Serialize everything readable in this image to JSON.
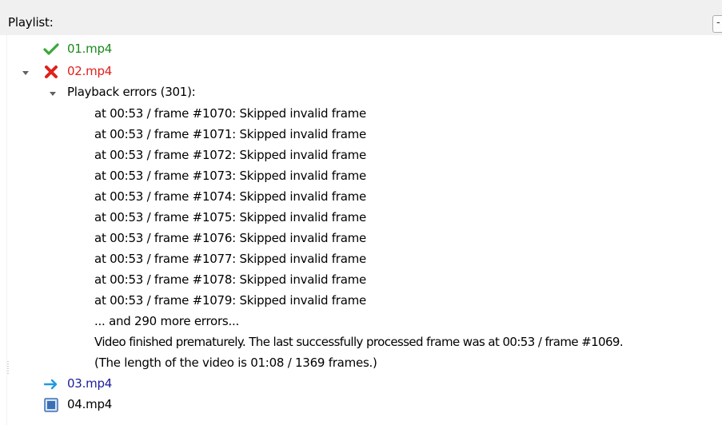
{
  "header": {
    "playlist_label": "Playlist:",
    "collapse_glyph": "-"
  },
  "playlist": {
    "items": [
      {
        "name": "01.mp4",
        "status": "success",
        "icon": "checkmark-icon",
        "color": "#1b8a1b"
      },
      {
        "name": "02.mp4",
        "status": "error",
        "icon": "red-x-icon",
        "color": "#e0201c",
        "expanded": true
      },
      {
        "name": "03.mp4",
        "status": "current",
        "icon": "arrow-right-icon",
        "color": "#1c1c9c"
      },
      {
        "name": "04.mp4",
        "status": "pending",
        "icon": "square-icon",
        "color": "#000000"
      }
    ],
    "errors": {
      "group_label": "Playback errors (301):",
      "lines": [
        "at 00:53 / frame #1070: Skipped invalid frame",
        "at 00:53 / frame #1071: Skipped invalid frame",
        "at 00:53 / frame #1072: Skipped invalid frame",
        "at 00:53 / frame #1073: Skipped invalid frame",
        "at 00:53 / frame #1074: Skipped invalid frame",
        "at 00:53 / frame #1075: Skipped invalid frame",
        "at 00:53 / frame #1076: Skipped invalid frame",
        "at 00:53 / frame #1077: Skipped invalid frame",
        "at 00:53 / frame #1078: Skipped invalid frame",
        "at 00:53 / frame #1079: Skipped invalid frame"
      ],
      "more": "... and 290 more errors...",
      "summary": "Video finished prematurely. The last successfully processed frame was at 00:53 / frame #1069.",
      "length_note": "(The length of the video is 01:08 / 1369 frames.)"
    }
  },
  "colors": {
    "success": "#1b8a1b",
    "error": "#e0201c",
    "current": "#1c1c9c",
    "header_bg": "#f0f0f0",
    "arrow_icon": "#1f9be0",
    "square_icon": "#3c6fb4"
  }
}
